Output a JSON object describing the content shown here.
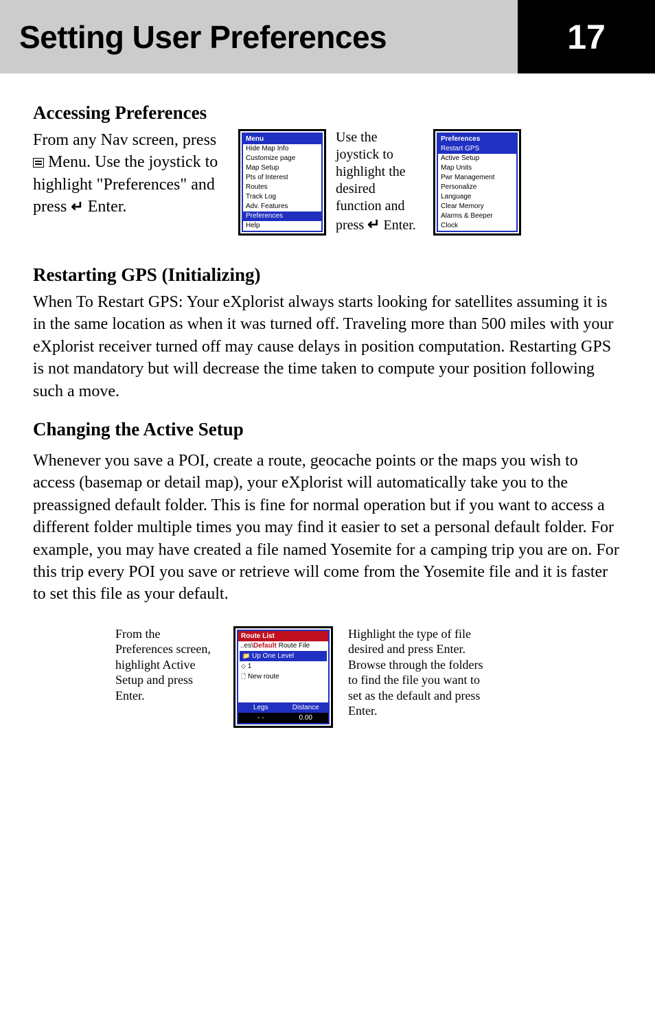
{
  "header": {
    "title": "Setting User Preferences",
    "page": "17"
  },
  "accessing": {
    "title": "Accessing Preferences",
    "intro_1": "From any Nav screen, press ",
    "intro_2": " Menu.  Use the joystick to highlight \"Preferences\" and press ",
    "intro_3": " Enter.",
    "enter_glyph": "↵",
    "menu_screenshot": {
      "header": "Menu",
      "items": [
        "Hide Map Info",
        "Customize page",
        "Map Setup",
        "Pts of Interest",
        "Routes",
        "Track Log",
        "Adv. Features",
        "Preferences",
        "Help"
      ],
      "highlighted_index": 7
    },
    "use_text_1": "Use the joystick to highlight the desired function and press ",
    "use_text_2": " Enter.",
    "prefs_screenshot": {
      "header": "Preferences",
      "items": [
        "Restart GPS",
        "Active Setup",
        "Map Units",
        "Pwr Management",
        "Personalize",
        "Language",
        "Clear Memory",
        "Alarms & Beeper",
        "Clock"
      ],
      "highlighted_index": 0
    }
  },
  "restarting": {
    "title": "Restarting GPS (Initializing)",
    "body": "When To Restart GPS:  Your eXplorist always starts looking for satellites assuming it is in the same location as when it was turned off.  Traveling more than 500 miles with your eXplorist receiver turned off may cause delays in position computation.  Restarting GPS is not mandatory but will decrease the time taken to compute your position following such a move."
  },
  "active_setup": {
    "title": "Changing the Active Setup",
    "body": "Whenever you save a POI, create a route, geocache points or the maps you wish to access (basemap or detail map), your eXplorist will automatically take you to the preassigned default folder.  This is fine for normal operation but if you want to access a different folder multiple times you may find it easier to set a personal default folder.  For example, you may have created a file named Yosemite for a camping trip you are on.  For this trip every POI you save or retrieve will come from the Yosemite file and it is faster to set this file as your default.",
    "left_text": "From the Preferences screen, highlight Active Setup and press Enter.",
    "route_screenshot": {
      "header": "Route List",
      "path_prefix": "..es\\",
      "path_red": "Default",
      "path_suffix": " Route File",
      "up": "Up One Level",
      "items": [
        "1",
        "New route"
      ],
      "footer_cols": [
        "Legs",
        "Distance"
      ],
      "footer_vals": [
        "- -",
        "0.00"
      ]
    },
    "right_text": "Highlight the type of file desired and press  Enter.  Browse through the folders to find the file you want to set as the default and press   Enter."
  }
}
